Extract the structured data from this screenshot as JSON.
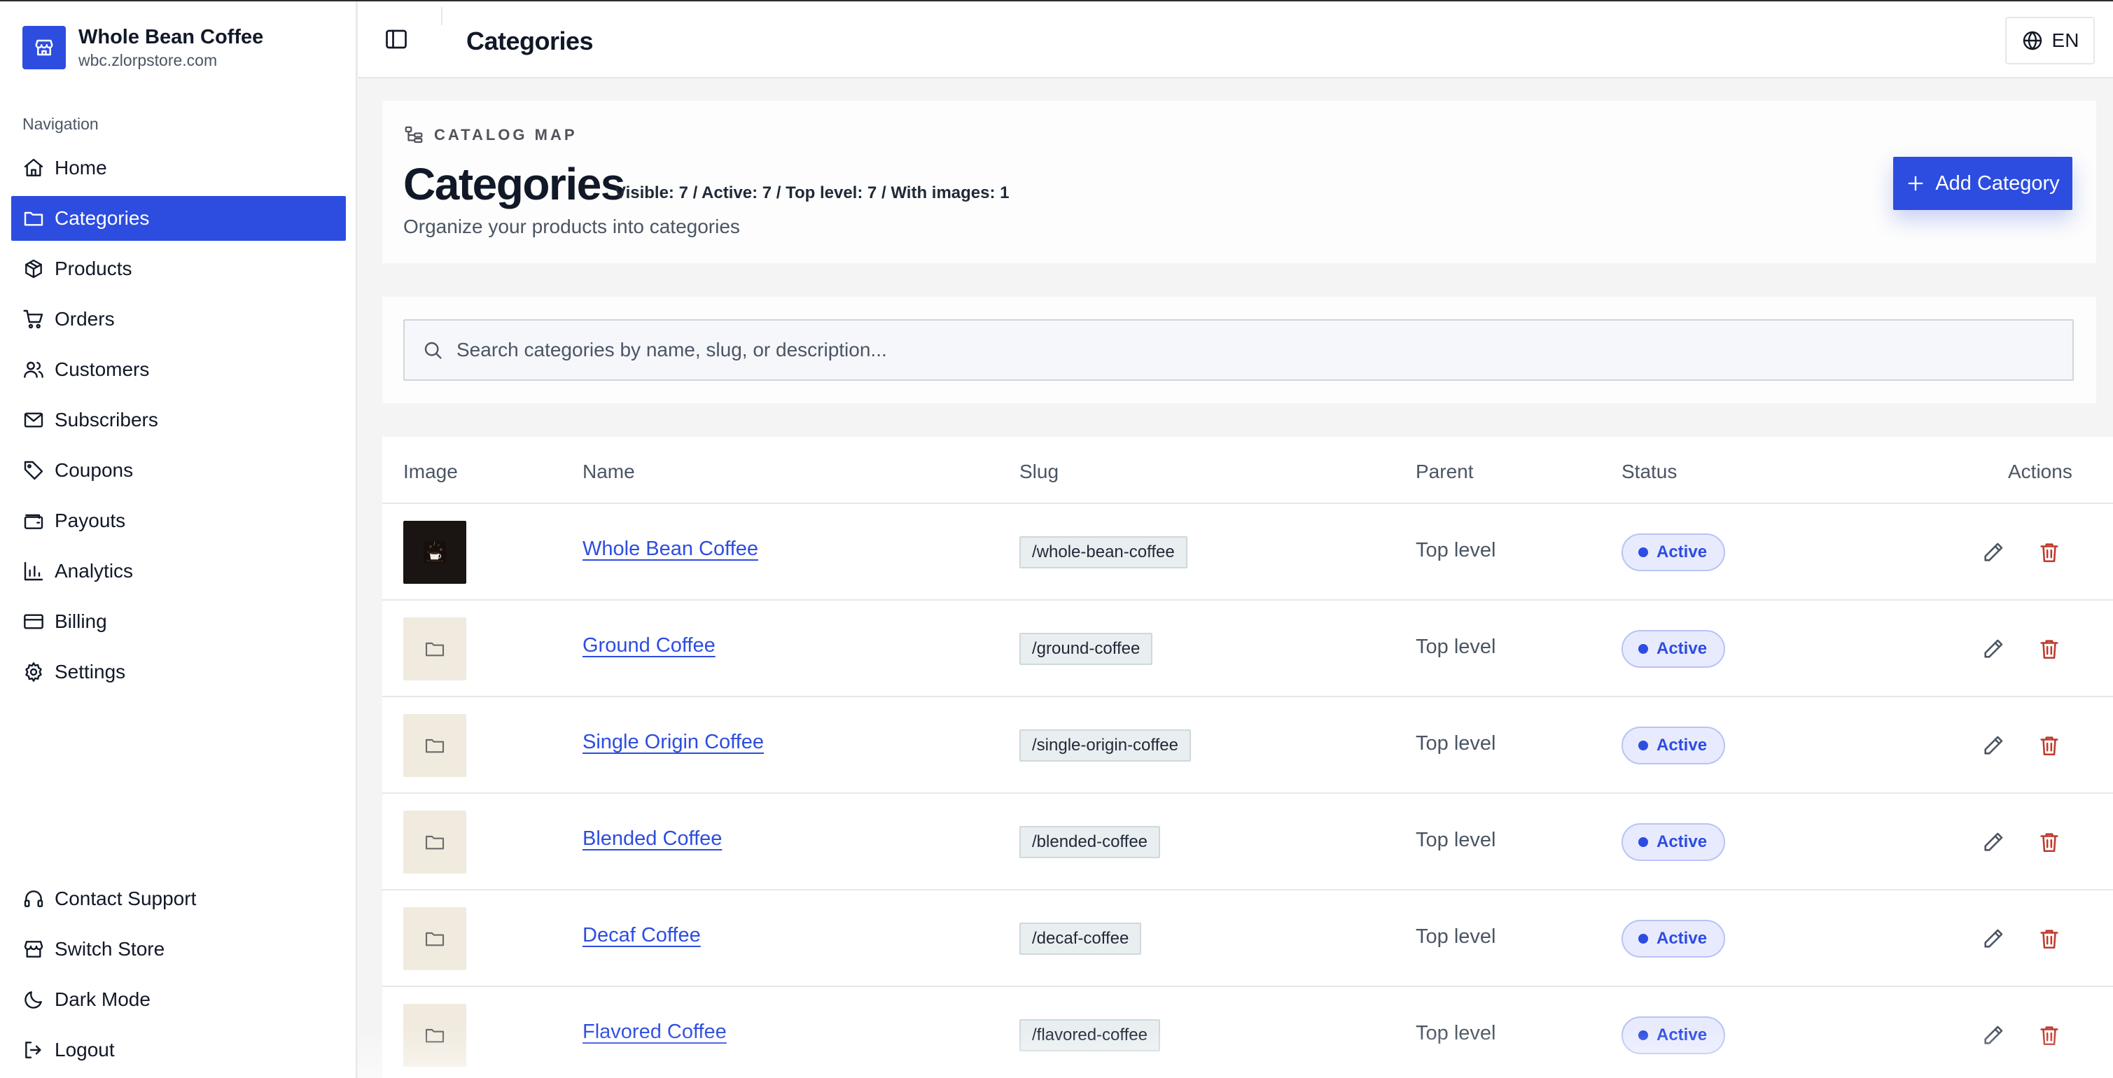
{
  "store": {
    "name": "Whole Bean Coffee",
    "domain": "wbc.zlorpstore.com",
    "icon": "store-icon"
  },
  "sidebar": {
    "caption": "Navigation",
    "items": [
      {
        "label": "Home",
        "icon": "home-icon",
        "active": false
      },
      {
        "label": "Categories",
        "icon": "folder-icon",
        "active": true
      },
      {
        "label": "Products",
        "icon": "package-icon",
        "active": false
      },
      {
        "label": "Orders",
        "icon": "cart-icon",
        "active": false
      },
      {
        "label": "Customers",
        "icon": "users-icon",
        "active": false
      },
      {
        "label": "Subscribers",
        "icon": "mail-icon",
        "active": false
      },
      {
        "label": "Coupons",
        "icon": "tag-icon",
        "active": false
      },
      {
        "label": "Payouts",
        "icon": "wallet-icon",
        "active": false
      },
      {
        "label": "Analytics",
        "icon": "bar-chart-icon",
        "active": false
      },
      {
        "label": "Billing",
        "icon": "credit-card-icon",
        "active": false
      },
      {
        "label": "Settings",
        "icon": "gear-icon",
        "active": false
      }
    ],
    "bottom_items": [
      {
        "label": "Contact Support",
        "icon": "headset-icon"
      },
      {
        "label": "Switch Store",
        "icon": "store-icon"
      },
      {
        "label": "Dark Mode",
        "icon": "moon-icon"
      },
      {
        "label": "Logout",
        "icon": "logout-icon"
      }
    ]
  },
  "topbar": {
    "title": "Categories",
    "language": "EN"
  },
  "header": {
    "eyebrow": "CATALOG MAP",
    "title": "Categories",
    "stats": "Visible: 7 / Active: 7 / Top level: 7 / With images: 1",
    "subtitle": "Organize your products into categories",
    "add_label": "Add Category"
  },
  "search": {
    "placeholder": "Search categories by name, slug, or description...",
    "value": ""
  },
  "table": {
    "columns": [
      "Image",
      "Name",
      "Slug",
      "Parent",
      "Status",
      "Actions"
    ],
    "rows": [
      {
        "name": "Whole Bean Coffee",
        "slug": "/whole-bean-coffee",
        "parent": "Top level",
        "status": "Active",
        "has_image": true
      },
      {
        "name": "Ground Coffee",
        "slug": "/ground-coffee",
        "parent": "Top level",
        "status": "Active",
        "has_image": false
      },
      {
        "name": "Single Origin Coffee",
        "slug": "/single-origin-coffee",
        "parent": "Top level",
        "status": "Active",
        "has_image": false
      },
      {
        "name": "Blended Coffee",
        "slug": "/blended-coffee",
        "parent": "Top level",
        "status": "Active",
        "has_image": false
      },
      {
        "name": "Decaf Coffee",
        "slug": "/decaf-coffee",
        "parent": "Top level",
        "status": "Active",
        "has_image": false
      },
      {
        "name": "Flavored Coffee",
        "slug": "/flavored-coffee",
        "parent": "Top level",
        "status": "Active",
        "has_image": false
      }
    ]
  },
  "colors": {
    "accent": "#2d4de0",
    "badge_bg": "#e8ebfd",
    "delete": "#c0392b"
  }
}
